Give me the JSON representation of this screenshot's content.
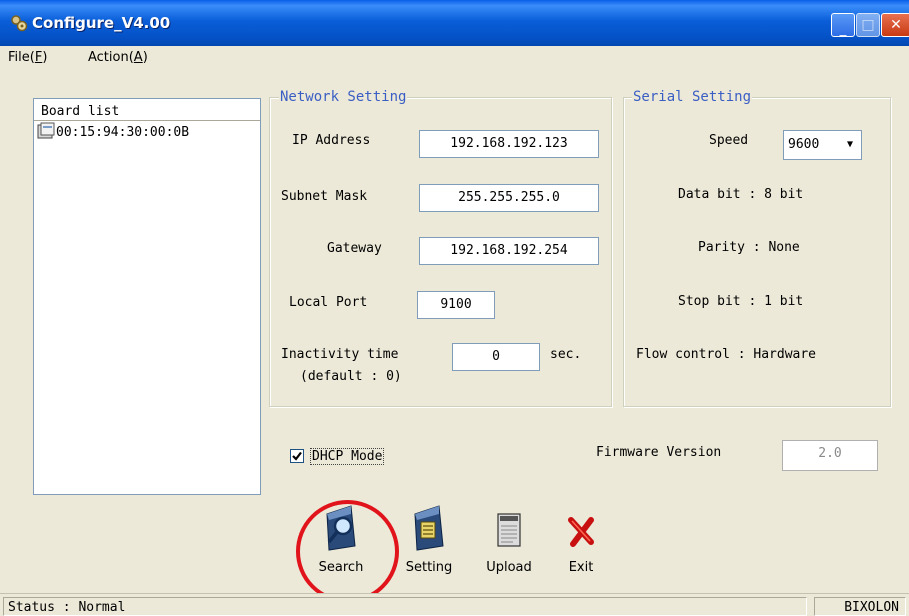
{
  "window": {
    "title": "Configure_V4.00"
  },
  "menu": {
    "file": {
      "label": "File(",
      "key": "F",
      "close": ")"
    },
    "action": {
      "label": "Action(",
      "key": "A",
      "close": ")"
    }
  },
  "board_list": {
    "header": "Board list",
    "items": [
      {
        "label": "00:15:94:30:00:0B"
      }
    ]
  },
  "network": {
    "title": "Network Setting",
    "ip_label": "IP Address",
    "ip_value": "192.168.192.123",
    "subnet_label": "Subnet Mask",
    "subnet_value": "255.255.255.0",
    "gateway_label": "Gateway",
    "gateway_value": "192.168.192.254",
    "port_label": "Local Port",
    "port_value": "9100",
    "inactivity_label": "Inactivity time",
    "inactivity_default": "(default : 0)",
    "inactivity_value": "0",
    "inactivity_unit": "sec."
  },
  "serial": {
    "title": "Serial Setting",
    "speed_label": "Speed",
    "speed_value": "9600",
    "databit": "Data bit : 8 bit",
    "parity": "Parity : None",
    "stopbit": "Stop bit : 1 bit",
    "flow": "Flow control : Hardware"
  },
  "dhcp": {
    "label": "DHCP Mode",
    "checked": true
  },
  "firmware": {
    "label": "Firmware Version",
    "value": "2.0"
  },
  "toolbar": {
    "search": "Search",
    "setting": "Setting",
    "upload": "Upload",
    "exit": "Exit"
  },
  "status": {
    "text": "Status : Normal",
    "brand": "BIXOLON"
  },
  "colors": {
    "titlebar": "#0a5ee8",
    "legend": "#3a5ec4",
    "highlight": "#e1131b",
    "face": "#ece9d8"
  }
}
